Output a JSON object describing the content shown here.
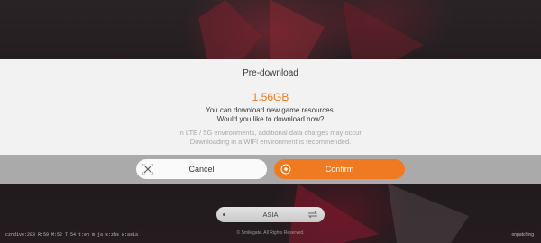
{
  "dialog": {
    "title": "Pre-download",
    "size": "1.56GB",
    "message_line1": "You can download new game resources.",
    "message_line2": "Would you like to download now?",
    "note_line1": "In LTE / 5G environments, additional data charges may occur.",
    "note_line2": "Downloading in a WIFI environment is recommended.",
    "cancel_label": "Cancel",
    "cancel_icon": "close-x-icon",
    "confirm_label": "Confirm",
    "confirm_icon": "confirm-circle-icon"
  },
  "region": {
    "label": "ASIA",
    "icon": "swap-arrows-icon"
  },
  "footer": {
    "build_info": "czndive:203 R:59 M:52 T:54 t:en m:ja s:zhs w:asia",
    "copyright": "© Smilegate. All Rights Reserved.",
    "status": "onpatching"
  },
  "colors": {
    "accent": "#f07a22",
    "dialog_bg": "#f2f2f2",
    "button_bar_bg": "#d2d2d2"
  }
}
